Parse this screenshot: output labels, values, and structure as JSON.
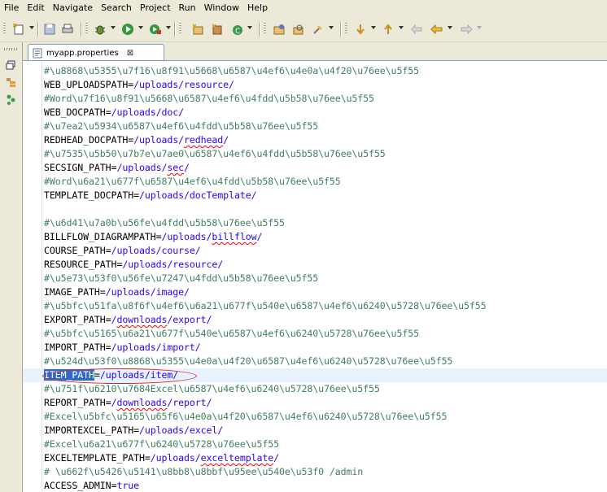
{
  "menu": [
    "File",
    "Edit",
    "Navigate",
    "Search",
    "Project",
    "Run",
    "Window",
    "Help"
  ],
  "toolbar_icons": [
    "new-icon",
    "save-icon",
    "print-icon",
    "debug-icon",
    "run-icon",
    "external-tools-icon",
    "new-java-project-icon",
    "new-package-icon",
    "new-class-icon",
    "open-type-icon",
    "search-icon",
    "toggle-mark-icon",
    "next-annotation-icon",
    "previous-annotation-icon",
    "last-edit-icon",
    "back-icon",
    "forward-icon"
  ],
  "left_rail_icons": [
    "view-menu-icon",
    "restore-icon",
    "package-explorer-icon",
    "hierarchy-icon"
  ],
  "editor": {
    "tab_title": "myapp.properties",
    "close_glyph": "⊠"
  },
  "lines": [
    {
      "kind": "comment",
      "text": "#\\u8868\\u5355\\u7f16\\u8f91\\u5668\\u6587\\u4ef6\\u4e0a\\u4f20\\u76ee\\u5f55"
    },
    {
      "kind": "kv",
      "key": "WEB_UPLOADSPATH",
      "value": "/uploads/resource/"
    },
    {
      "kind": "comment",
      "text": "#Word\\u7f16\\u8f91\\u5668\\u6587\\u4ef6\\u4fdd\\u5b58\\u76ee\\u5f55"
    },
    {
      "kind": "kv",
      "key": "WEB_DOCPATH",
      "value": "/uploads/doc/"
    },
    {
      "kind": "comment",
      "text": "#\\u7ea2\\u5934\\u6587\\u4ef6\\u4fdd\\u5b58\\u76ee\\u5f55"
    },
    {
      "kind": "kv",
      "key": "REDHEAD_DOCPATH",
      "value_pre": "/uploads/",
      "value_squig": "redhead",
      "value_post": "/"
    },
    {
      "kind": "comment",
      "text": "#\\u7535\\u5b50\\u7b7e\\u7ae0\\u6587\\u4ef6\\u4fdd\\u5b58\\u76ee\\u5f55"
    },
    {
      "kind": "kv",
      "key": "SECSIGN_PATH",
      "value_pre": "/uploads/",
      "value_squig": "sec",
      "value_post": "/"
    },
    {
      "kind": "comment",
      "text": "#Word\\u6a21\\u677f\\u6587\\u4ef6\\u4fdd\\u5b58\\u76ee\\u5f55"
    },
    {
      "kind": "kv",
      "key": "TEMPLATE_DOCPATH",
      "value": "/uploads/docTemplate/"
    },
    {
      "kind": "blank",
      "text": ""
    },
    {
      "kind": "comment",
      "text": "#\\u6d41\\u7a0b\\u56fe\\u4fdd\\u5b58\\u76ee\\u5f55"
    },
    {
      "kind": "kv",
      "key": "BILLFLOW_DIAGRAMPATH",
      "value_pre": "/uploads/",
      "value_squig": "billflow",
      "value_post": "/"
    },
    {
      "kind": "kv",
      "key": "COURSE_PATH",
      "value": "/uploads/course/"
    },
    {
      "kind": "kv",
      "key": "RESOURCE_PATH",
      "value": "/uploads/resource/"
    },
    {
      "kind": "comment",
      "text": "#\\u5e73\\u53f0\\u56fe\\u7247\\u4fdd\\u5b58\\u76ee\\u5f55"
    },
    {
      "kind": "kv",
      "key": "IMAGE_PATH",
      "value": "/uploads/image/"
    },
    {
      "kind": "comment",
      "text": "#\\u5bfc\\u51fa\\u8f6f\\u4ef6\\u6a21\\u677f\\u540e\\u6587\\u4ef6\\u6240\\u5728\\u76ee\\u5f55"
    },
    {
      "kind": "kv",
      "key": "EXPORT_PATH",
      "value_pre": "/",
      "value_squig": "downloads",
      "value_post": "/export/"
    },
    {
      "kind": "comment",
      "text": "#\\u5bfc\\u5165\\u6a21\\u677f\\u540e\\u6587\\u4ef6\\u6240\\u5728\\u76ee\\u5f55"
    },
    {
      "kind": "kv",
      "key": "IMPORT_PATH",
      "value": "/uploads/import/"
    },
    {
      "kind": "comment",
      "text": "#\\u524d\\u53f0\\u8868\\u5355\\u4e0a\\u4f20\\u6587\\u4ef6\\u6240\\u5728\\u76ee\\u5f55"
    },
    {
      "kind": "kv-sel",
      "key": "ITEM_PATH",
      "value": "/uploads/item/"
    },
    {
      "kind": "comment",
      "text": "#\\u751f\\u6210\\u7684Excel\\u6587\\u4ef6\\u6240\\u5728\\u76ee\\u5f55"
    },
    {
      "kind": "kv",
      "key": "REPORT_PATH",
      "value_pre": "/",
      "value_squig": "downloads",
      "value_post": "/report/"
    },
    {
      "kind": "comment",
      "text": "#Excel\\u5bfc\\u5165\\u65f6\\u4e0a\\u4f20\\u6587\\u4ef6\\u6240\\u5728\\u76ee\\u5f55"
    },
    {
      "kind": "kv",
      "key": "IMPORTEXCEL_PATH",
      "value": "/uploads/excel/"
    },
    {
      "kind": "comment",
      "text": "#Excel\\u6a21\\u677f\\u6240\\u5728\\u76ee\\u5f55"
    },
    {
      "kind": "kv",
      "key": "EXCELTEMPLATE_PATH",
      "value_pre": "/uploads/",
      "value_squig": "exceltemplate",
      "value_post": "/"
    },
    {
      "kind": "comment",
      "text": "# \\u662f\\u5426\\u5141\\u8bb8\\u8bbf\\u95ee\\u540e\\u53f0 /admin"
    },
    {
      "kind": "kv",
      "key": "ACCESS_ADMIN",
      "value": "true"
    }
  ]
}
